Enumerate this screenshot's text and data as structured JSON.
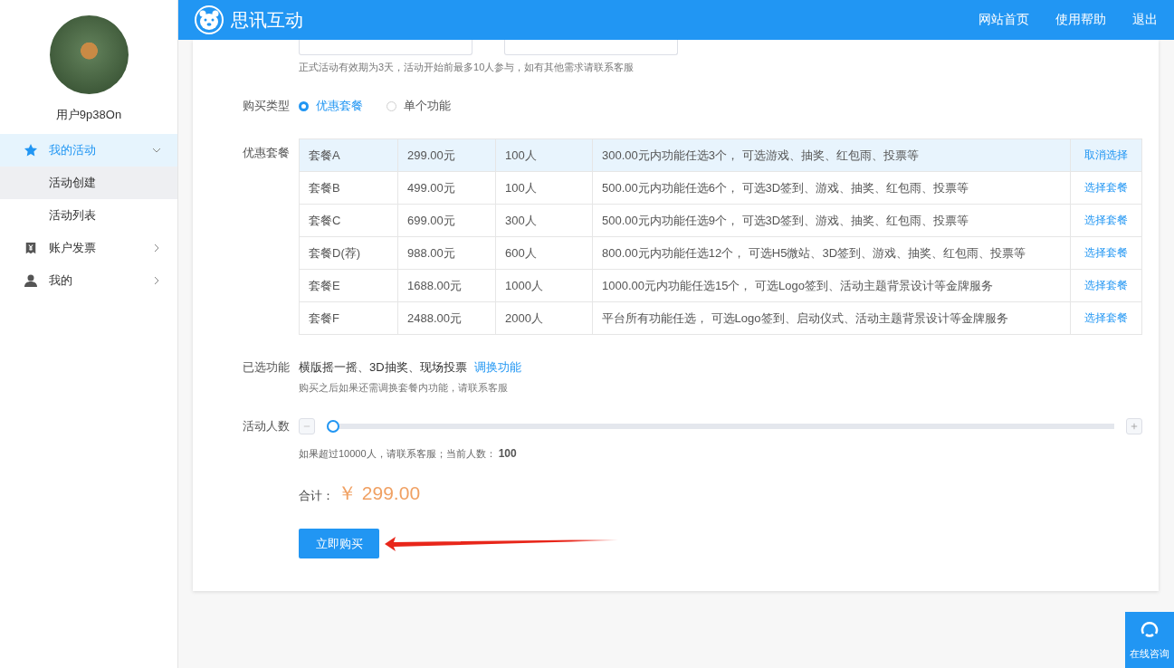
{
  "header": {
    "logo_text": "思讯互动",
    "nav": [
      {
        "label": "网站首页"
      },
      {
        "label": "使用帮助"
      },
      {
        "label": "退出"
      }
    ]
  },
  "sidebar": {
    "username": "用户9p38On",
    "menu": [
      {
        "label": "我的活动",
        "active": true,
        "expanded": true,
        "children": [
          {
            "label": "活动创建",
            "selected": true
          },
          {
            "label": "活动列表",
            "selected": false
          }
        ]
      },
      {
        "label": "账户发票",
        "active": false,
        "expanded": false
      },
      {
        "label": "我的",
        "active": false,
        "expanded": false
      }
    ]
  },
  "form": {
    "date_hint": "正式活动有效期为3天，活动开始前最多10人参与，如有其他需求请联系客服",
    "purchase_type": {
      "label": "购买类型",
      "options": [
        {
          "label": "优惠套餐",
          "selected": true
        },
        {
          "label": "单个功能",
          "selected": false
        }
      ]
    },
    "packages": {
      "label": "优惠套餐",
      "rows": [
        {
          "name": "套餐A",
          "price": "299.00元",
          "people": "100人",
          "description": "300.00元内功能任选3个， 可选游戏、抽奖、红包雨、投票等",
          "action": "取消选择",
          "selected": true
        },
        {
          "name": "套餐B",
          "price": "499.00元",
          "people": "100人",
          "description": "500.00元内功能任选6个， 可选3D签到、游戏、抽奖、红包雨、投票等",
          "action": "选择套餐",
          "selected": false
        },
        {
          "name": "套餐C",
          "price": "699.00元",
          "people": "300人",
          "description": "500.00元内功能任选9个， 可选3D签到、游戏、抽奖、红包雨、投票等",
          "action": "选择套餐",
          "selected": false
        },
        {
          "name": "套餐D(荐)",
          "price": "988.00元",
          "people": "600人",
          "description": "800.00元内功能任选12个， 可选H5微站、3D签到、游戏、抽奖、红包雨、投票等",
          "action": "选择套餐",
          "selected": false
        },
        {
          "name": "套餐E",
          "price": "1688.00元",
          "people": "1000人",
          "description": "1000.00元内功能任选15个， 可选Logo签到、活动主题背景设计等金牌服务",
          "action": "选择套餐",
          "selected": false
        },
        {
          "name": "套餐F",
          "price": "2488.00元",
          "people": "2000人",
          "description": "平台所有功能任选， 可选Logo签到、启动仪式、活动主题背景设计等金牌服务",
          "action": "选择套餐",
          "selected": false
        }
      ]
    },
    "selected_features": {
      "label": "已选功能",
      "value": "横版摇一摇、3D抽奖、现场投票",
      "link": "调换功能",
      "hint": "购买之后如果还需调换套餐内功能，请联系客服"
    },
    "participants": {
      "label": "活动人数",
      "level": 0,
      "hint": "如果超过10000人，请联系客服；当前人数： **100**"
    },
    "total": {
      "label": "合计：",
      "amount": "￥ 299.00"
    },
    "submit": "立即购买"
  },
  "consult_button": "在线咨询"
}
